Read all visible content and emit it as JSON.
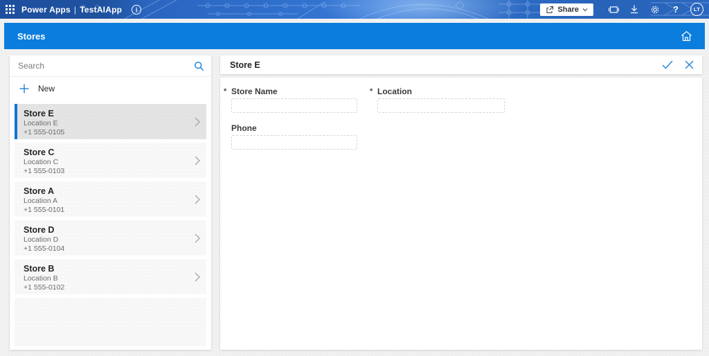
{
  "colors": {
    "topbar_blue": "#2a65c0",
    "header_blue": "#0b7ddd",
    "accent_blue": "#0078d4",
    "selected_border": "#1176d2",
    "page_bg": "#f1f1f1"
  },
  "topbar": {
    "app_name": "Power Apps",
    "divider": "|",
    "env_name": "TestAIApp",
    "share_label": "Share",
    "help_label": "?",
    "avatar_initials": "LT"
  },
  "app_header": {
    "title": "Stores"
  },
  "list_panel": {
    "search_placeholder": "Search",
    "search_value": "",
    "new_label": "New",
    "stores": [
      {
        "name": "Store E",
        "location": "Location E",
        "phone": "+1 555-0105",
        "selected": true
      },
      {
        "name": "Store C",
        "location": "Location C",
        "phone": "+1 555-0103",
        "selected": false
      },
      {
        "name": "Store A",
        "location": "Location A",
        "phone": "+1 555-0101",
        "selected": false
      },
      {
        "name": "Store D",
        "location": "Location D",
        "phone": "+1 555-0104",
        "selected": false
      },
      {
        "name": "Store B",
        "location": "Location B",
        "phone": "+1 555-0102",
        "selected": false
      }
    ]
  },
  "detail_panel": {
    "title": "Store E",
    "required_marker": "*",
    "fields": [
      {
        "label": "Store Name",
        "required": true,
        "value": ""
      },
      {
        "label": "Location",
        "required": true,
        "value": ""
      },
      {
        "label": "Phone",
        "required": false,
        "value": ""
      }
    ]
  }
}
